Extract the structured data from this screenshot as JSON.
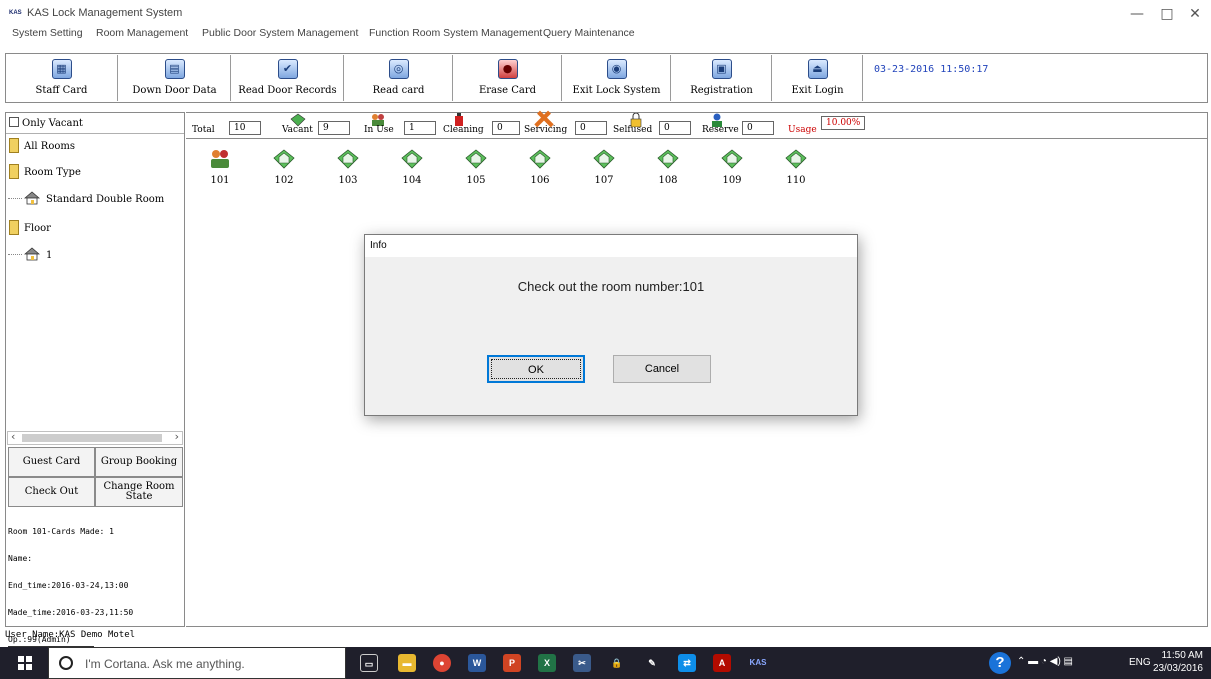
{
  "window": {
    "logo": "KAS",
    "title": "KAS Lock Management System",
    "minimize": "—",
    "maximize": "□",
    "close": "✕"
  },
  "menu": [
    "System Setting",
    "Room Management",
    "Public Door System Management",
    "Function Room System Management",
    "Query Maintenance"
  ],
  "toolbar": {
    "buttons": [
      {
        "label": "Staff Card",
        "icon": "staff-card-icon",
        "glyph": "▦"
      },
      {
        "label": "Down Door Data",
        "icon": "down-door-data-icon",
        "glyph": "▤"
      },
      {
        "label": "Read Door Records",
        "icon": "read-door-records-icon",
        "glyph": "✔"
      },
      {
        "label": "Read card",
        "icon": "read-card-icon",
        "glyph": "◎"
      },
      {
        "label": "Erase Card",
        "icon": "erase-card-icon",
        "glyph": "●"
      },
      {
        "label": "Exit Lock System",
        "icon": "exit-lock-system-icon",
        "glyph": "◉"
      },
      {
        "label": "Registration",
        "icon": "registration-icon",
        "glyph": "▣"
      },
      {
        "label": "Exit Login",
        "icon": "exit-login-icon",
        "glyph": "⏏"
      }
    ],
    "datetime": "03-23-2016 11:50:17"
  },
  "left": {
    "only_vacant": "Only Vacant",
    "tree": {
      "all_rooms": "All Rooms",
      "room_type": "Room Type",
      "room_type_item": "Standard Double Room",
      "floor": "Floor",
      "floor_item": "1"
    },
    "buttons": {
      "guest_card": "Guest Card",
      "group_booking": "Group Booking",
      "check_out": "Check Out",
      "change_room_state": "Change Room State"
    },
    "card_info": {
      "header": "Room 101-Cards Made: 1",
      "name": "Name:",
      "end_time": "End_time:2016-03-24,13:00",
      "made_time": "Made_time:2016-03-23,11:50",
      "op": "Op.:99(Admin)"
    }
  },
  "status": {
    "total_label": "Total",
    "total": "10",
    "vacant_label": "Vacant",
    "vacant": "9",
    "inuse_label": "In Use",
    "inuse": "1",
    "cleaning_label": "Cleaning",
    "cleaning": "0",
    "servicing_label": "Servicing",
    "servicing": "0",
    "selfused_label": "Selfused",
    "selfused": "0",
    "reserve_label": "Reserve",
    "reserve": "0",
    "usage_label": "Usage",
    "usage": "10.00%"
  },
  "rooms": [
    {
      "number": "101",
      "state": "in-use"
    },
    {
      "number": "102",
      "state": "vacant"
    },
    {
      "number": "103",
      "state": "vacant"
    },
    {
      "number": "104",
      "state": "vacant"
    },
    {
      "number": "105",
      "state": "vacant"
    },
    {
      "number": "106",
      "state": "vacant"
    },
    {
      "number": "107",
      "state": "vacant"
    },
    {
      "number": "108",
      "state": "vacant"
    },
    {
      "number": "109",
      "state": "vacant"
    },
    {
      "number": "110",
      "state": "vacant"
    }
  ],
  "user_bar": "User Name:KAS Demo Motel",
  "dialog": {
    "title": "Info",
    "message": "Check out the room number:101",
    "ok": "OK",
    "cancel": "Cancel"
  },
  "taskbar": {
    "search_placeholder": "I'm Cortana. Ask me anything.",
    "apps": [
      {
        "name": "task-view-icon",
        "glyph": "▭",
        "color": "#1f1f2b"
      },
      {
        "name": "file-explorer-icon",
        "glyph": "▬",
        "color": "#e8b830"
      },
      {
        "name": "chrome-icon",
        "glyph": "●",
        "color": "#dd4433"
      },
      {
        "name": "word-icon",
        "glyph": "W",
        "color": "#2b579a"
      },
      {
        "name": "powerpoint-icon",
        "glyph": "P",
        "color": "#d04423"
      },
      {
        "name": "excel-icon",
        "glyph": "X",
        "color": "#217346"
      },
      {
        "name": "tools-icon",
        "glyph": "✂",
        "color": "#3a5a8a"
      },
      {
        "name": "lock-icon",
        "glyph": "🔒",
        "color": "#1f1f2b"
      },
      {
        "name": "paint-icon",
        "glyph": "✎",
        "color": "#1f1f2b"
      },
      {
        "name": "teamviewer-icon",
        "glyph": "⇄",
        "color": "#0e8ee9"
      },
      {
        "name": "acrobat-icon",
        "glyph": "A",
        "color": "#b30b00"
      },
      {
        "name": "kas-icon",
        "glyph": "KAS",
        "color": "#1f1f2b"
      }
    ],
    "language": "ENG",
    "time": "11:50 AM",
    "date": "23/03/2016"
  },
  "colors": {
    "accent_blue": "#2244bb",
    "usage_red": "#cc0000",
    "folder_yellow": "#f0d060",
    "taskbar": "#1f1f2b"
  }
}
